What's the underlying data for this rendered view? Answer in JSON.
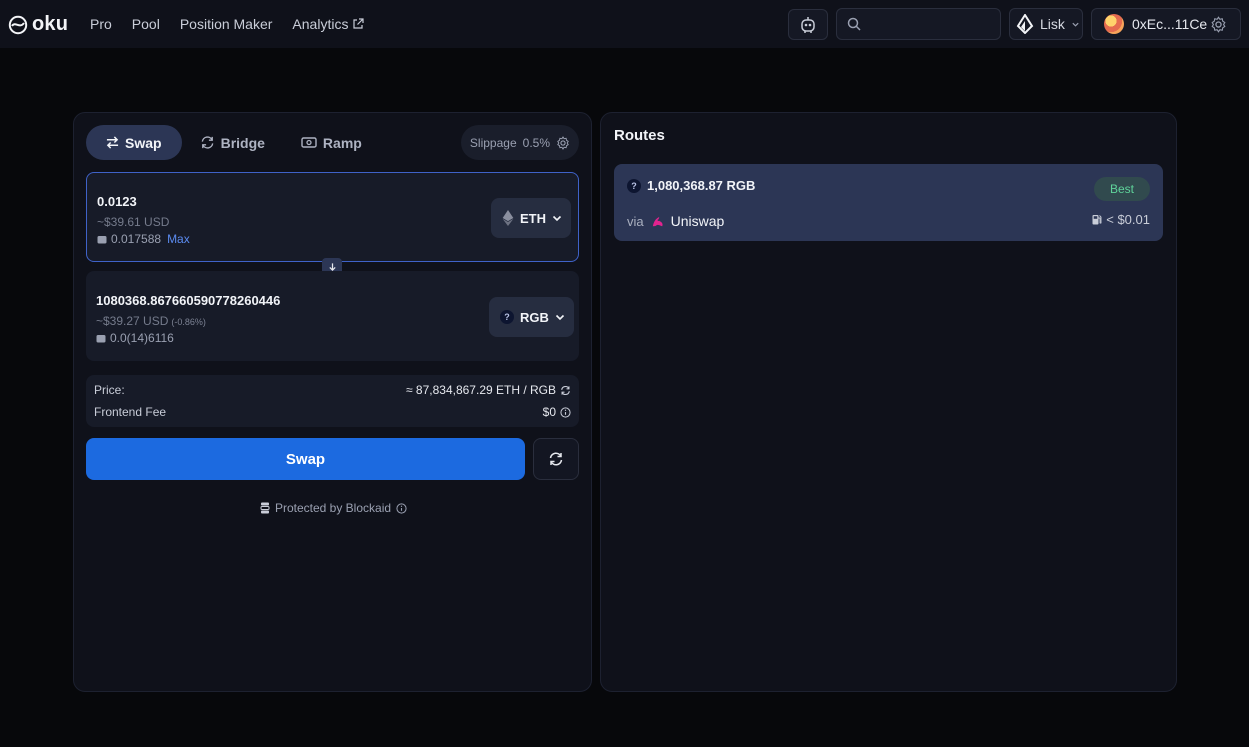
{
  "brand": {
    "name": "oku"
  },
  "nav": {
    "items": [
      {
        "label": "Pro"
      },
      {
        "label": "Pool"
      },
      {
        "label": "Position Maker"
      },
      {
        "label": "Analytics"
      }
    ]
  },
  "header": {
    "search_placeholder": "",
    "chain": "Lisk",
    "account": "0xEc...11Ce"
  },
  "tabs": [
    {
      "label": "Swap"
    },
    {
      "label": "Bridge"
    },
    {
      "label": "Ramp"
    }
  ],
  "slippage": {
    "label": "Slippage",
    "value": "0.5%"
  },
  "from": {
    "amount": "0.0123",
    "usd": "~$39.61 USD",
    "balance": "0.017588",
    "max_label": "Max",
    "token": "ETH"
  },
  "to": {
    "amount": "1080368.867660590778260446",
    "usd": "~$39.27 USD",
    "usd_change": "(-0.86%)",
    "balance": "0.0(14)6116",
    "token": "RGB"
  },
  "info": {
    "price_label": "Price:",
    "price_value": "≈ 87,834,867.29 ETH / RGB",
    "fee_label": "Frontend Fee",
    "fee_value": "$0"
  },
  "actions": {
    "swap_label": "Swap"
  },
  "footer": {
    "protected_text": "Protected by Blockaid"
  },
  "routes": {
    "title": "Routes",
    "items": [
      {
        "amount": "1,080,368.87 RGB",
        "badge": "Best",
        "via_label": "via",
        "dex": "Uniswap",
        "gas": "< $0.01"
      }
    ]
  },
  "colors": {
    "accent": "#1c6ae0",
    "active_tab": "#2c3655",
    "best_badge_text": "#5fd39a",
    "max_link": "#5b8bf0"
  }
}
